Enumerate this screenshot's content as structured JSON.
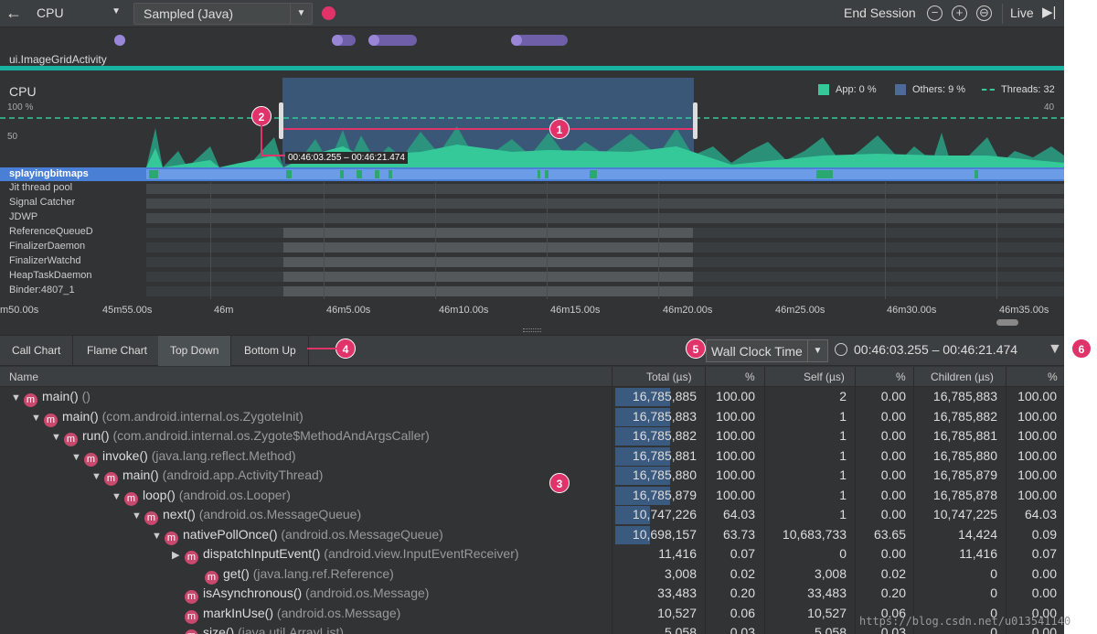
{
  "toolbar": {
    "back_icon": "arrow-left-icon",
    "profiler": "CPU",
    "config": "Sampled (Java)",
    "end_session": "End Session",
    "zoom_out": "−",
    "zoom_in": "+",
    "zoom_reset": "⊖",
    "live": "Live",
    "record_color": "#e0336a"
  },
  "events": {
    "activity": "ui.ImageGridActivity"
  },
  "cpu": {
    "label": "CPU",
    "y100": "100 %",
    "y50": "50",
    "yright": "40",
    "legend_app": "App: 0 %",
    "legend_others": "Others: 9 %",
    "legend_threads": "Threads: 32",
    "selection_range": "00:46:03.255 – 00:46:21.474"
  },
  "threads": [
    {
      "name": "splayingbitmaps",
      "selected": true
    },
    {
      "name": "Jit thread pool"
    },
    {
      "name": "Signal Catcher"
    },
    {
      "name": "JDWP"
    },
    {
      "name": "ReferenceQueueD"
    },
    {
      "name": "FinalizerDaemon"
    },
    {
      "name": "FinalizerWatchd"
    },
    {
      "name": "HeapTaskDaemon"
    },
    {
      "name": "Binder:4807_1"
    }
  ],
  "axis": [
    "m50.00s",
    "45m55.00s",
    "46m",
    "46m5.00s",
    "46m10.00s",
    "46m15.00s",
    "46m20.00s",
    "46m25.00s",
    "46m30.00s",
    "46m35.00s"
  ],
  "tabs": [
    "Call Chart",
    "Flame Chart",
    "Top Down",
    "Bottom Up"
  ],
  "clock": {
    "mode": "Wall Clock Time",
    "range": "00:46:03.255 – 00:46:21.474",
    "filter_icon": "filter-icon",
    "clock_icon": "clock-icon"
  },
  "columns": {
    "name": "Name",
    "total": "Total (µs)",
    "pct1": "%",
    "self": "Self (µs)",
    "pct2": "%",
    "children": "Children (µs)",
    "pct3": "%"
  },
  "rows": [
    {
      "fn": "main()",
      "pkg": "()",
      "total": "16,785,885",
      "tp": "100.00",
      "self": "2",
      "sp": "0.00",
      "child": "16,785,883",
      "cp": "100.00",
      "bar": 1.0
    },
    {
      "fn": "main()",
      "pkg": "(com.android.internal.os.ZygoteInit)",
      "total": "16,785,883",
      "tp": "100.00",
      "self": "1",
      "sp": "0.00",
      "child": "16,785,882",
      "cp": "100.00",
      "bar": 1.0
    },
    {
      "fn": "run()",
      "pkg": "(com.android.internal.os.Zygote$MethodAndArgsCaller)",
      "total": "16,785,882",
      "tp": "100.00",
      "self": "1",
      "sp": "0.00",
      "child": "16,785,881",
      "cp": "100.00",
      "bar": 1.0
    },
    {
      "fn": "invoke()",
      "pkg": "(java.lang.reflect.Method)",
      "total": "16,785,881",
      "tp": "100.00",
      "self": "1",
      "sp": "0.00",
      "child": "16,785,880",
      "cp": "100.00",
      "bar": 1.0
    },
    {
      "fn": "main()",
      "pkg": "(android.app.ActivityThread)",
      "total": "16,785,880",
      "tp": "100.00",
      "self": "1",
      "sp": "0.00",
      "child": "16,785,879",
      "cp": "100.00",
      "bar": 1.0
    },
    {
      "fn": "loop()",
      "pkg": "(android.os.Looper)",
      "total": "16,785,879",
      "tp": "100.00",
      "self": "1",
      "sp": "0.00",
      "child": "16,785,878",
      "cp": "100.00",
      "bar": 1.0
    },
    {
      "fn": "next()",
      "pkg": "(android.os.MessageQueue)",
      "total": "10,747,226",
      "tp": "64.03",
      "self": "1",
      "sp": "0.00",
      "child": "10,747,225",
      "cp": "64.03",
      "bar": 0.64
    },
    {
      "fn": "nativePollOnce()",
      "pkg": "(android.os.MessageQueue)",
      "total": "10,698,157",
      "tp": "63.73",
      "self": "10,683,733",
      "sp": "63.65",
      "child": "14,424",
      "cp": "0.09",
      "bar": 0.637
    },
    {
      "fn": "dispatchInputEvent()",
      "pkg": "(android.view.InputEventReceiver)",
      "total": "11,416",
      "tp": "0.07",
      "self": "0",
      "sp": "0.00",
      "child": "11,416",
      "cp": "0.07",
      "bar": 0
    },
    {
      "fn": "get()",
      "pkg": "(java.lang.ref.Reference)",
      "total": "3,008",
      "tp": "0.02",
      "self": "3,008",
      "sp": "0.02",
      "child": "0",
      "cp": "0.00",
      "bar": 0
    },
    {
      "fn": "isAsynchronous()",
      "pkg": "(android.os.Message)",
      "total": "33,483",
      "tp": "0.20",
      "self": "33,483",
      "sp": "0.20",
      "child": "0",
      "cp": "0.00",
      "bar": 0
    },
    {
      "fn": "markInUse()",
      "pkg": "(android.os.Message)",
      "total": "10,527",
      "tp": "0.06",
      "self": "10,527",
      "sp": "0.06",
      "child": "0",
      "cp": "0.00",
      "bar": 0
    },
    {
      "fn": "size()",
      "pkg": "(java.util.ArrayList)",
      "total": "5,058",
      "tp": "0.03",
      "self": "5,058",
      "sp": "0.03",
      "child": "0",
      "cp": "0.00",
      "bar": 0
    }
  ],
  "callouts": [
    "1",
    "2",
    "3",
    "4",
    "5",
    "6"
  ],
  "watermark": "https://blog.csdn.net/u013541140"
}
